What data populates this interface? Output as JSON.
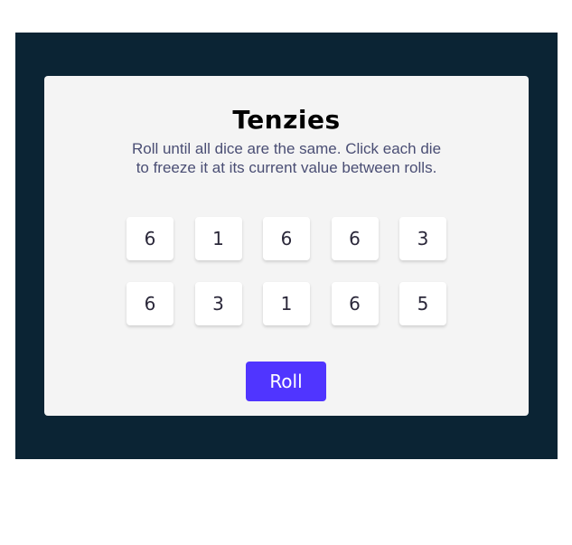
{
  "game": {
    "title": "Tenzies",
    "instructions": "Roll until all dice are the same. Click each die to freeze it at its current value between rolls.",
    "dice": [
      "6",
      "1",
      "6",
      "6",
      "3",
      "6",
      "3",
      "1",
      "6",
      "5"
    ],
    "roll_label": "Roll"
  },
  "colors": {
    "background": "#0b2434",
    "card": "#f4f4f4",
    "die_face": "#ffffff",
    "roll_button": "#5035ff"
  }
}
